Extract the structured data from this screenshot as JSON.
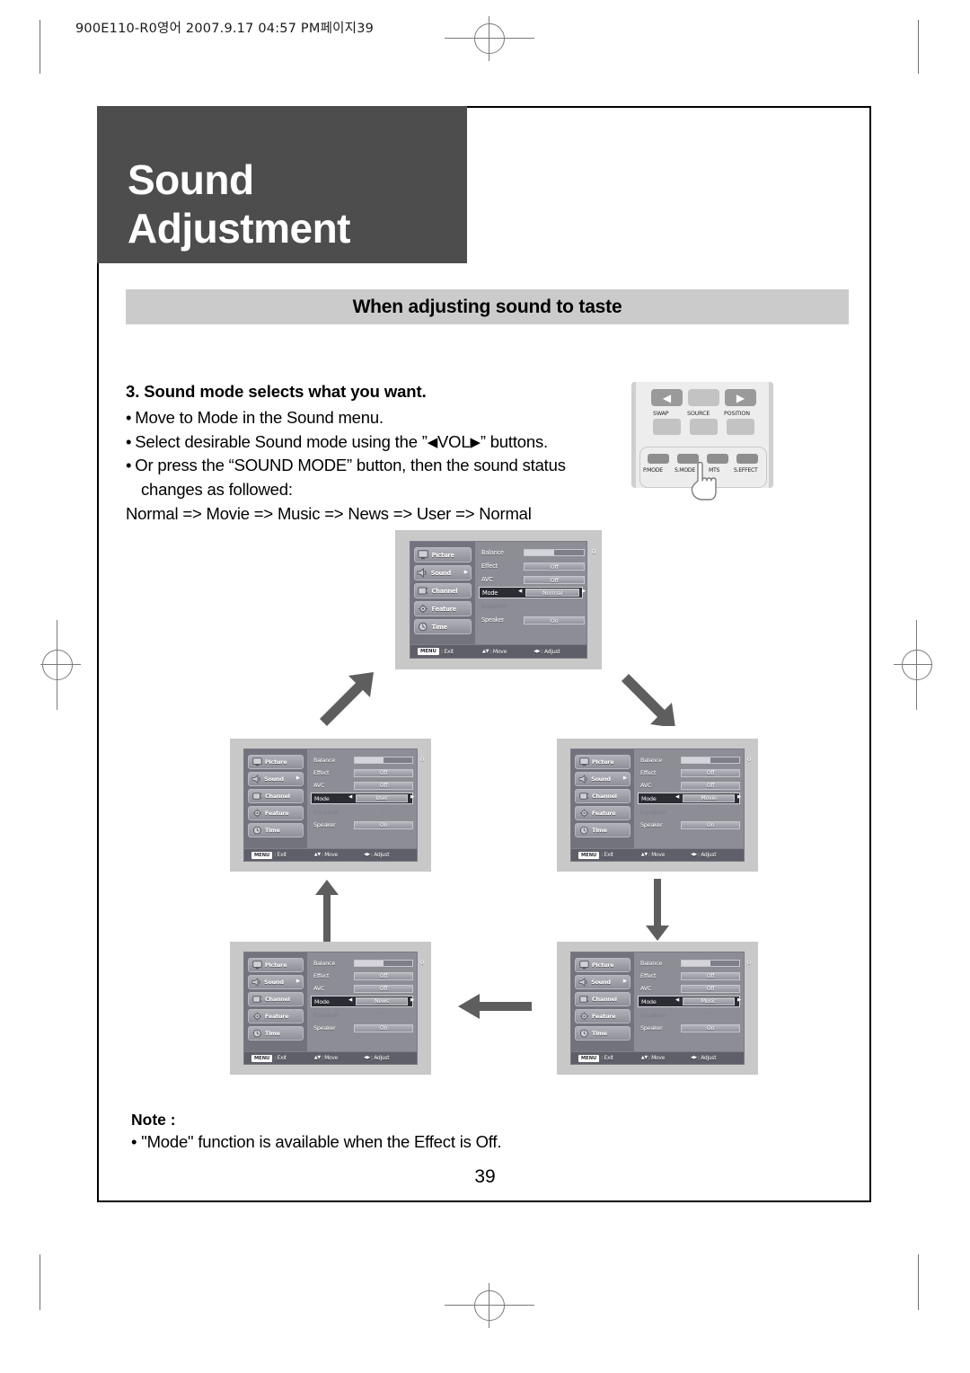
{
  "slug": "900E110-R0영어  2007.9.17 04:57 PM페이지39",
  "chapter_title": "Sound Adjustment",
  "subtitle": "When adjusting sound to taste",
  "instructions": {
    "step_heading": "3. Sound mode selects what you want.",
    "bullet_1": "Move to Mode in the Sound menu.",
    "bullet_2_pre": "Select desirable Sound mode using the ”",
    "bullet_2_key": "VOL",
    "bullet_2_post": "” buttons.",
    "bullet_3": "Or press the “SOUND MODE” button, then the sound status",
    "bullet_3_cont": "changes as followed:",
    "cycle": "Normal => Movie  => Music => News => User  => Normal"
  },
  "remote": {
    "left_arrow_icon": "left-triangle-icon",
    "right_arrow_icon": "right-triangle-icon",
    "labels_top": [
      "SWAP",
      "SOURCE",
      "POSITION"
    ],
    "labels_bottom": [
      "P.MODE",
      "S.MODE",
      "MTS",
      "S.EFFECT"
    ],
    "pressed_button": "S.MODE",
    "hand_icon": "pointing-hand-icon"
  },
  "osd": {
    "sidebar": [
      {
        "label": "Picture",
        "icon": "monitor-icon"
      },
      {
        "label": "Sound",
        "icon": "speaker-icon",
        "selected": true,
        "arrow": "▶"
      },
      {
        "label": "Channel",
        "icon": "tv-icon"
      },
      {
        "label": "Feature",
        "icon": "gear-icon"
      },
      {
        "label": "Time",
        "icon": "clock-icon"
      }
    ],
    "rows": {
      "balance": "Balance",
      "effect": "Effect",
      "avc": "AVC",
      "mode": "Mode",
      "equalizer": "Equalizer",
      "speaker": "Speaker"
    },
    "values": {
      "balance_number": "0",
      "balance_fill_pct": 50,
      "effect": "Off",
      "avc": "Off",
      "equalizer_arrow": "▶",
      "speaker": "On"
    },
    "status": {
      "menu_chip": "MENU",
      "exit": ": Exit",
      "move_arrows": "▲▼",
      "move": ": Move",
      "adjust_arrows": "◀▶",
      "adjust": ": Adjust"
    },
    "left_caret": "◀",
    "right_caret": "▶"
  },
  "osd_panels": [
    {
      "id": "panel-normal",
      "mode_value": "Normal"
    },
    {
      "id": "panel-user",
      "mode_value": "User"
    },
    {
      "id": "panel-movie",
      "mode_value": "Movie"
    },
    {
      "id": "panel-news",
      "mode_value": "News"
    },
    {
      "id": "panel-music",
      "mode_value": "Music"
    }
  ],
  "flow_arrows": [
    {
      "name": "arrow-user-to-normal",
      "direction": "up-right"
    },
    {
      "name": "arrow-normal-to-movie",
      "direction": "down-right"
    },
    {
      "name": "arrow-news-to-user",
      "direction": "up"
    },
    {
      "name": "arrow-movie-to-music",
      "direction": "down"
    },
    {
      "name": "arrow-music-to-news",
      "direction": "left"
    }
  ],
  "note": {
    "heading": "Note :",
    "body": "• \"Mode\" function is available when the Effect is Off."
  },
  "page_number": "39",
  "colors": {
    "title_block": "#4d4d4d",
    "subtitle_bar": "#cbcbcb",
    "osd_frame": "#c8c8c8",
    "osd_body": "#8d8d96",
    "osd_sidebar": "#73737d",
    "osd_selected_row": "#2c2c34",
    "arrow_gray": "#5e5e5e"
  }
}
